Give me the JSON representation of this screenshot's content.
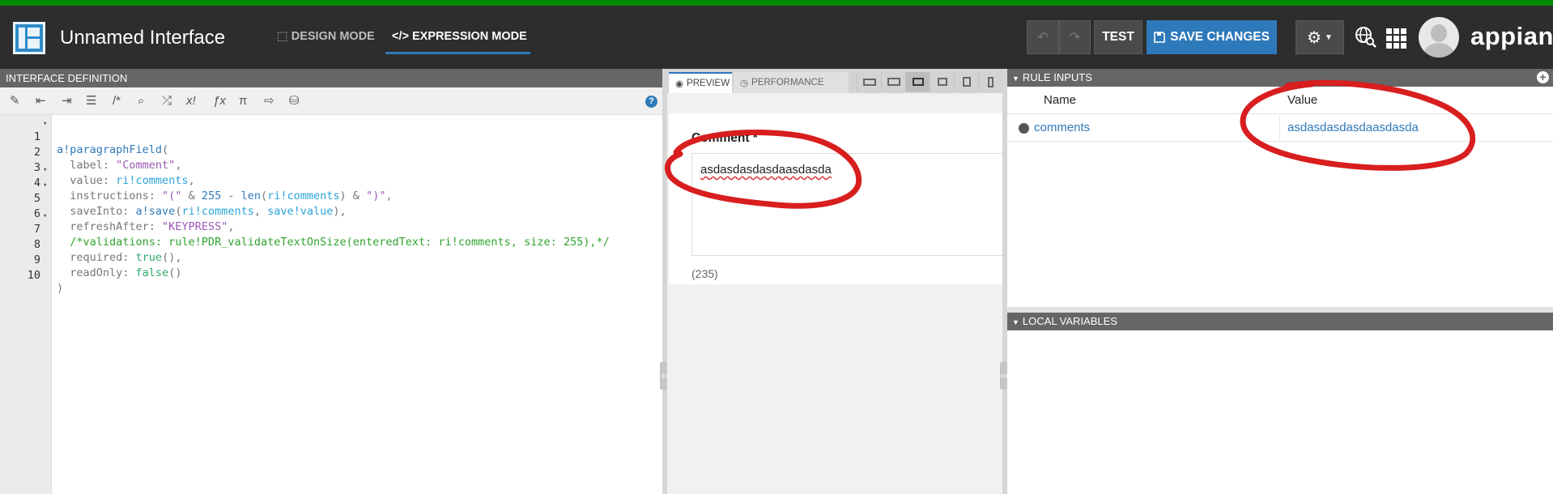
{
  "colors": {
    "accent": "#2e79b9",
    "top_strip": "#008a00",
    "topbar": "#2d2d2d",
    "annotation": "#d81e1e"
  },
  "header": {
    "title": "Unnamed Interface",
    "design_mode": "DESIGN MODE",
    "expression_mode": "EXPRESSION MODE",
    "active_mode": "EXPRESSION MODE",
    "test_label": "TEST",
    "save_label": "SAVE CHANGES",
    "brand": "appian"
  },
  "editor": {
    "title": "INTERFACE DEFINITION",
    "toolbar_icons": [
      "magic-wand-icon",
      "outdent-icon",
      "indent-icon",
      "list-icon",
      "comment-icon",
      "search-icon",
      "shuffle-icon",
      "x-exclaim-icon",
      "function-icon",
      "pi-icon",
      "export-icon",
      "database-search-icon"
    ],
    "lines": [
      {
        "n": "1",
        "fold": "▾"
      },
      {
        "n": "2",
        "fold": ""
      },
      {
        "n": "3",
        "fold": ""
      },
      {
        "n": "4",
        "fold": "▾"
      },
      {
        "n": "5",
        "fold": "▾"
      },
      {
        "n": "6",
        "fold": ""
      },
      {
        "n": "7",
        "fold": "▾"
      },
      {
        "n": "8",
        "fold": ""
      },
      {
        "n": "9",
        "fold": ""
      },
      {
        "n": "10",
        "fold": ""
      }
    ],
    "code": {
      "l1a": "a!paragraphField",
      "l1b": "(",
      "l2a": "  label: ",
      "l2b": "\"Comment\"",
      "l2c": ",",
      "l3a": "  value: ",
      "l3b": "ri!comments",
      "l3c": ",",
      "l4a": "  instructions: ",
      "l4b": "\"(\"",
      "l4c": " & ",
      "l4d": "255",
      "l4e": " - ",
      "l4f": "len",
      "l4g": "(",
      "l4h": "ri!comments",
      "l4i": ") & ",
      "l4j": "\")\"",
      "l4k": ",",
      "l5a": "  saveInto: ",
      "l5b": "a!save",
      "l5c": "(",
      "l5d": "ri!comments",
      "l5e": ", ",
      "l5f": "save!value",
      "l5g": "),",
      "l6a": "  refreshAfter: ",
      "l6b": "\"KEYPRESS\"",
      "l6c": ",",
      "l7": "  /*validations: rule!PDR_validateTextOnSize(enteredText: ri!comments, size: 255),*/",
      "l8a": "  required: ",
      "l8b": "true",
      "l8c": "(),",
      "l9a": "  readOnly: ",
      "l9b": "false",
      "l9c": "()",
      "l10": ")"
    }
  },
  "preview": {
    "tab_preview": "PREVIEW",
    "tab_performance": "PERFORMANCE",
    "field_label": "Comment *",
    "field_value": "asdasdasdasdaasdasda",
    "counter": "(235)"
  },
  "rule_inputs": {
    "title": "RULE INPUTS",
    "col_name": "Name",
    "col_value": "Value",
    "rows": [
      {
        "name": "comments",
        "value": "asdasdasdasdaasdasda"
      }
    ]
  },
  "local_variables": {
    "title": "LOCAL VARIABLES"
  }
}
